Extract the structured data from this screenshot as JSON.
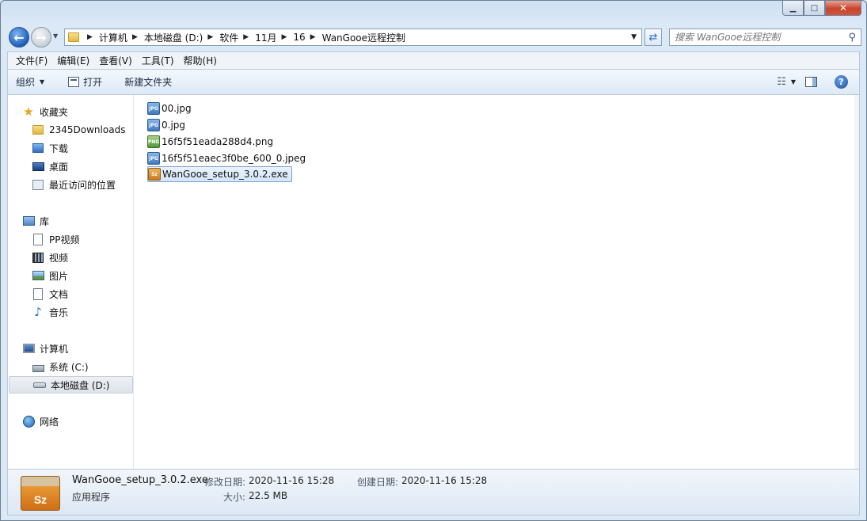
{
  "window": {
    "minimize": "▁",
    "maximize": "□",
    "close": "✕"
  },
  "address": {
    "crumbs": [
      "计算机",
      "本地磁盘 (D:)",
      "软件",
      "11月",
      "16",
      "WanGooe远程控制"
    ],
    "search_placeholder": "搜索 WanGooe远程控制"
  },
  "menu": [
    "文件(F)",
    "编辑(E)",
    "查看(V)",
    "工具(T)",
    "帮助(H)"
  ],
  "toolbar": {
    "organize": "组织",
    "open": "打开",
    "new_folder": "新建文件夹"
  },
  "nav": {
    "favorites": {
      "label": "收藏夹",
      "items": [
        "2345Downloads",
        "下载",
        "桌面",
        "最近访问的位置"
      ]
    },
    "libraries": {
      "label": "库",
      "items": [
        "PP视频",
        "视频",
        "图片",
        "文档",
        "音乐"
      ]
    },
    "computer": {
      "label": "计算机",
      "items": [
        "系统 (C:)",
        "本地磁盘 (D:)"
      ]
    },
    "network": {
      "label": "网络"
    }
  },
  "files": [
    {
      "name": "00.jpg",
      "type": "jpg",
      "badge": "JPG"
    },
    {
      "name": "0.jpg",
      "type": "jpg",
      "badge": "JPG"
    },
    {
      "name": "16f5f51eada288d4.png",
      "type": "png",
      "badge": "PNG"
    },
    {
      "name": "16f5f51eaec3f0be_600_0.jpeg",
      "type": "jpg",
      "badge": "JPG"
    },
    {
      "name": "WanGooe_setup_3.0.2.exe",
      "type": "exe",
      "badge": "Sz",
      "selected": true
    }
  ],
  "details": {
    "icon_label": "Sz",
    "name": "WanGooe_setup_3.0.2.exe",
    "type": "应用程序",
    "modified_label": "修改日期:",
    "modified_value": "2020-11-16 15:28",
    "size_label": "大小:",
    "size_value": "22.5 MB",
    "created_label": "创建日期:",
    "created_value": "2020-11-16 15:28"
  }
}
